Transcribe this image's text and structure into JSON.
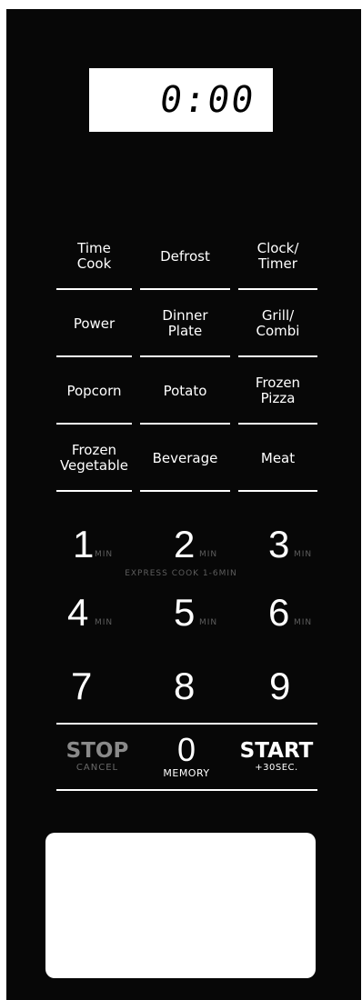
{
  "display": {
    "time": "0:00"
  },
  "function_keys": [
    {
      "id": "time-cook",
      "label": "Time\nCook"
    },
    {
      "id": "defrost",
      "label": "Defrost"
    },
    {
      "id": "clock-timer",
      "label": "Clock/\nTimer"
    },
    {
      "id": "power",
      "label": "Power"
    },
    {
      "id": "dinner-plate",
      "label": "Dinner\nPlate"
    },
    {
      "id": "grill-combi",
      "label": "Grill/\nCombi"
    },
    {
      "id": "popcorn",
      "label": "Popcorn"
    },
    {
      "id": "potato",
      "label": "Potato"
    },
    {
      "id": "frozen-pizza",
      "label": "Frozen\nPizza"
    },
    {
      "id": "frozen-vegetable",
      "label": "Frozen\nVegetable"
    },
    {
      "id": "beverage",
      "label": "Beverage"
    },
    {
      "id": "meat",
      "label": "Meat"
    }
  ],
  "number_keys": {
    "k1": {
      "digit": "1",
      "sub": "MIN"
    },
    "k2": {
      "digit": "2",
      "sub": "MIN"
    },
    "k3": {
      "digit": "3",
      "sub": "MIN"
    },
    "k4": {
      "digit": "4",
      "sub": "MIN"
    },
    "k5": {
      "digit": "5",
      "sub": "MIN"
    },
    "k6": {
      "digit": "6",
      "sub": "MIN"
    },
    "k7": {
      "digit": "7"
    },
    "k8": {
      "digit": "8"
    },
    "k9": {
      "digit": "9"
    }
  },
  "express_label": "EXPRESS COOK 1-6MIN",
  "stop": {
    "label": "STOP",
    "sub": "CANCEL"
  },
  "zero": {
    "digit": "0",
    "sub": "MEMORY"
  },
  "start": {
    "label": "START",
    "sub": "+30SEC."
  },
  "colors": {
    "panel": "#070707",
    "text": "#ffffff",
    "muted": "#5d5d5d",
    "stop": "#8a8a8a"
  }
}
